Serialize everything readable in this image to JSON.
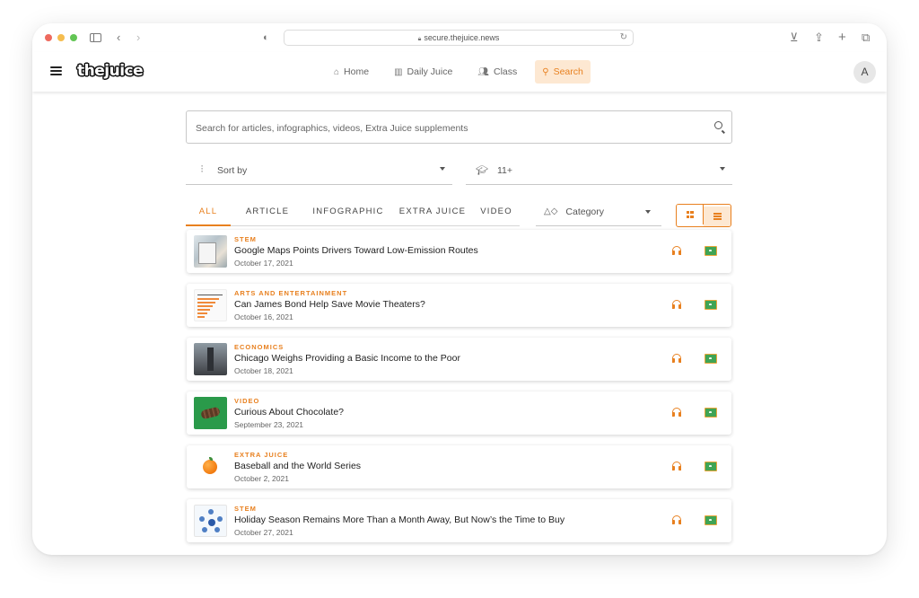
{
  "browser": {
    "url": "secure.thejuice.news",
    "traffic_colors": [
      "#ee6a5e",
      "#f5bd4f",
      "#62c554"
    ]
  },
  "header": {
    "logo": "thejuice",
    "nav": [
      {
        "label": "Home",
        "icon": "home-icon"
      },
      {
        "label": "Daily Juice",
        "icon": "juice-cup-icon"
      },
      {
        "label": "Class",
        "icon": "people-icon"
      },
      {
        "label": "Search",
        "icon": "search-icon",
        "active": true
      }
    ],
    "avatar": "A"
  },
  "search": {
    "placeholder": "Search for articles, infographics, videos, Extra Juice supplements",
    "value": ""
  },
  "filters": {
    "sort_label": "Sort by",
    "grade_label": "11+"
  },
  "tabs": [
    "ALL",
    "ARTICLE",
    "INFOGRAPHIC",
    "EXTRA JUICE",
    "VIDEO"
  ],
  "active_tab": "ALL",
  "category_label": "Category",
  "view_mode": "list",
  "accent_color": "#e8801f",
  "results": [
    {
      "category": "STEM",
      "title": "Google Maps Points Drivers Toward Low-Emission Routes",
      "date": "October 17, 2021",
      "thumb": "map"
    },
    {
      "category": "ARTS AND ENTERTAINMENT",
      "title": "Can James Bond Help Save Movie Theaters?",
      "date": "October 16, 2021",
      "thumb": "chart"
    },
    {
      "category": "ECONOMICS",
      "title": "Chicago Weighs Providing a Basic Income to the Poor",
      "date": "October 18, 2021",
      "thumb": "city"
    },
    {
      "category": "VIDEO",
      "title": "Curious About Chocolate?",
      "date": "September 23, 2021",
      "thumb": "video"
    },
    {
      "category": "EXTRA JUICE",
      "title": "Baseball and the World Series",
      "date": "October 2, 2021",
      "thumb": "orange"
    },
    {
      "category": "STEM",
      "title": "Holiday Season Remains More Than a Month Away, But Now’s the Time to Buy",
      "date": "October 27, 2021",
      "thumb": "holiday"
    }
  ]
}
